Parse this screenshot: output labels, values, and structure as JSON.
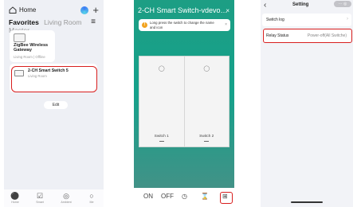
{
  "home": {
    "title": "Home",
    "tabs": [
      "Favorites",
      "Living Room",
      "Master"
    ],
    "gateway": {
      "name": "ZigBee Wireless Gateway",
      "status": "Living Room  |  Offline"
    },
    "switch_card": {
      "name": "2-CH Smart Switch 5",
      "room": "Living Room"
    },
    "edit_label": "Edit",
    "nav": [
      {
        "label": "Home",
        "icon": "house-icon"
      },
      {
        "label": "Smart",
        "icon": "checklist-icon"
      },
      {
        "label": "Ambient",
        "icon": "ambient-icon"
      },
      {
        "label": "Me",
        "icon": "profile-icon"
      }
    ]
  },
  "switch": {
    "title": "2-CH Smart Switch-vdevo…",
    "toast": "Long press the switch to change the name and icon",
    "gangs": [
      {
        "label": "Switch 1"
      },
      {
        "label": "Switch 2"
      }
    ],
    "bar": {
      "on": "ON",
      "off": "OFF"
    }
  },
  "setting": {
    "title": "Setting",
    "capsule": "···  ◎",
    "rows": [
      {
        "label": "Switch log",
        "value": ""
      },
      {
        "label": "Relay Status",
        "value": "Power-off(All Switche)"
      }
    ]
  },
  "colors": {
    "accent_teal": "#17a08a",
    "highlight_red": "#d81e1e",
    "home_orange": "#f06a35"
  }
}
